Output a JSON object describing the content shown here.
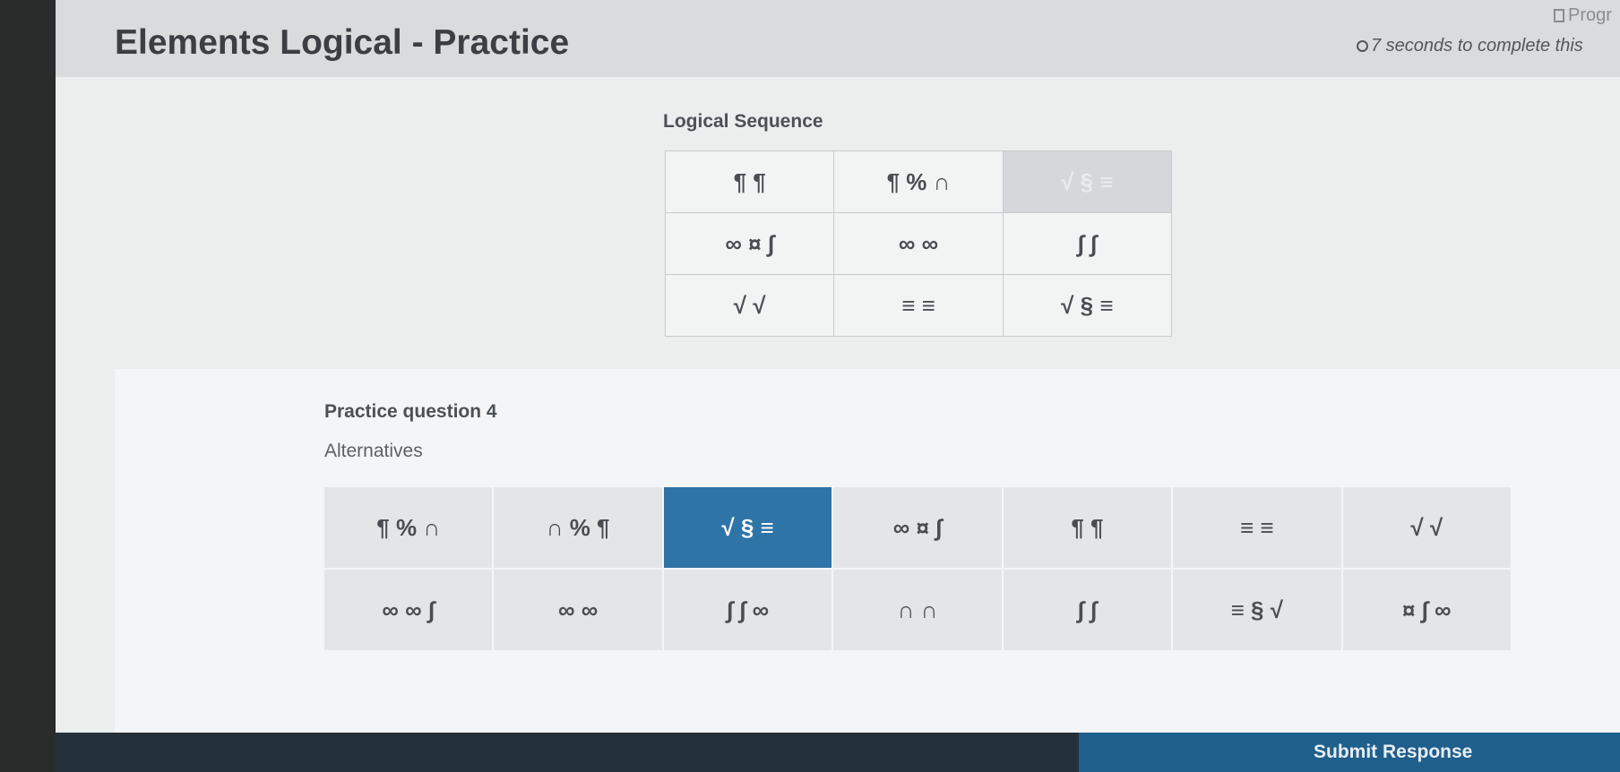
{
  "header": {
    "title": "Elements Logical - Practice",
    "progress_label": "Progr",
    "timer_text": "7 seconds to complete this"
  },
  "sequence": {
    "label": "Logical Sequence",
    "rows": [
      [
        "¶ ¶",
        "¶ % ∩",
        "√ § ≡"
      ],
      [
        "∞ ¤ ∫",
        "∞ ∞",
        "∫ ∫"
      ],
      [
        "√ √",
        "≡ ≡",
        "√ § ≡"
      ]
    ]
  },
  "question": {
    "title": "Practice question 4",
    "alternatives_label": "Alternatives",
    "alternatives": [
      [
        "¶ % ∩",
        "∩ % ¶",
        "√ § ≡",
        "∞ ¤ ∫",
        "¶ ¶",
        "≡ ≡",
        "√ √"
      ],
      [
        "∞ ∞ ∫",
        "∞ ∞",
        "∫ ∫ ∞",
        "∩ ∩",
        "∫ ∫",
        "≡ § √",
        "¤ ∫ ∞"
      ]
    ],
    "selected": "√ § ≡"
  },
  "footer": {
    "submit_label": "Submit Response"
  },
  "colors": {
    "selected_accent": "#2f74a7",
    "submit_bg": "#1f5f8c",
    "footer_bg": "#25313a"
  }
}
